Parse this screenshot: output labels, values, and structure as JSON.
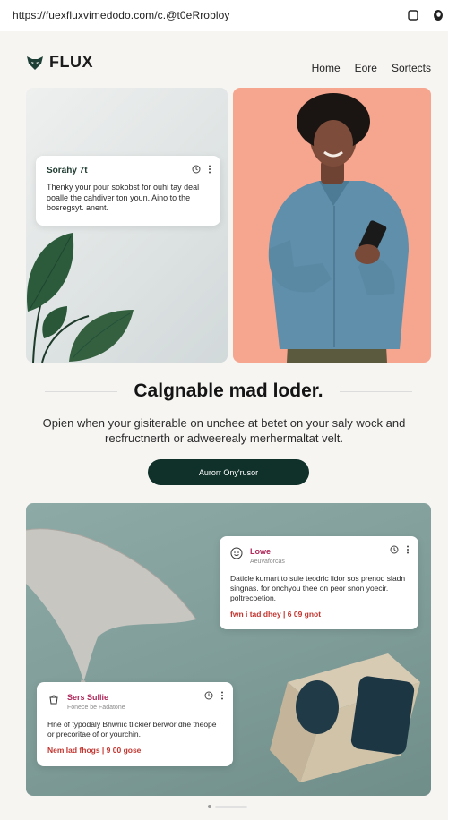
{
  "browser": {
    "url": "https://fuexfluxvimedodo.com/c.@t0eRrobloy"
  },
  "header": {
    "brand": "FLUX",
    "nav": [
      "Home",
      "Eore",
      "Sortects"
    ]
  },
  "top_card": {
    "title": "Sorahy 7t",
    "body": "Thenky your pour sokobst for ouhi tay deal ooalle the cahdiver ton youn. Aino to the bosregsyt. anent."
  },
  "main": {
    "headline": "Calgnable mad loder.",
    "subtext": "Opien when your gisiterable on unchee at betet on your saly wock and recfructnerth or adweerealy merhermaltat velt.",
    "cta_label": "Aurorr Ony'rusor"
  },
  "hero_cards": [
    {
      "title": "Lowe",
      "meta": "Aeuvaforcas",
      "body": "Daticle kumart to suie teodric lidor sos prenod sladn singnas. for onchyou thee on peor snon yoecir. poltrecoetion.",
      "price": "fwn i tad dhey | 6 09 gnot"
    },
    {
      "title": "Sers Sullie",
      "meta": "Fonece be Fadatone",
      "body": "Hne of typodaly Bhwriic tlickier berwor dhe theope or precoritae of or yourchin.",
      "price": "Nem Iad fhogs | 9 00 gose"
    }
  ],
  "colors": {
    "cta_bg": "#10312a",
    "accent_pink": "#b02a5c",
    "price_red": "#c2352f",
    "hero_teal": "#8eaaa6",
    "tile_salmon": "#f6a58f"
  }
}
